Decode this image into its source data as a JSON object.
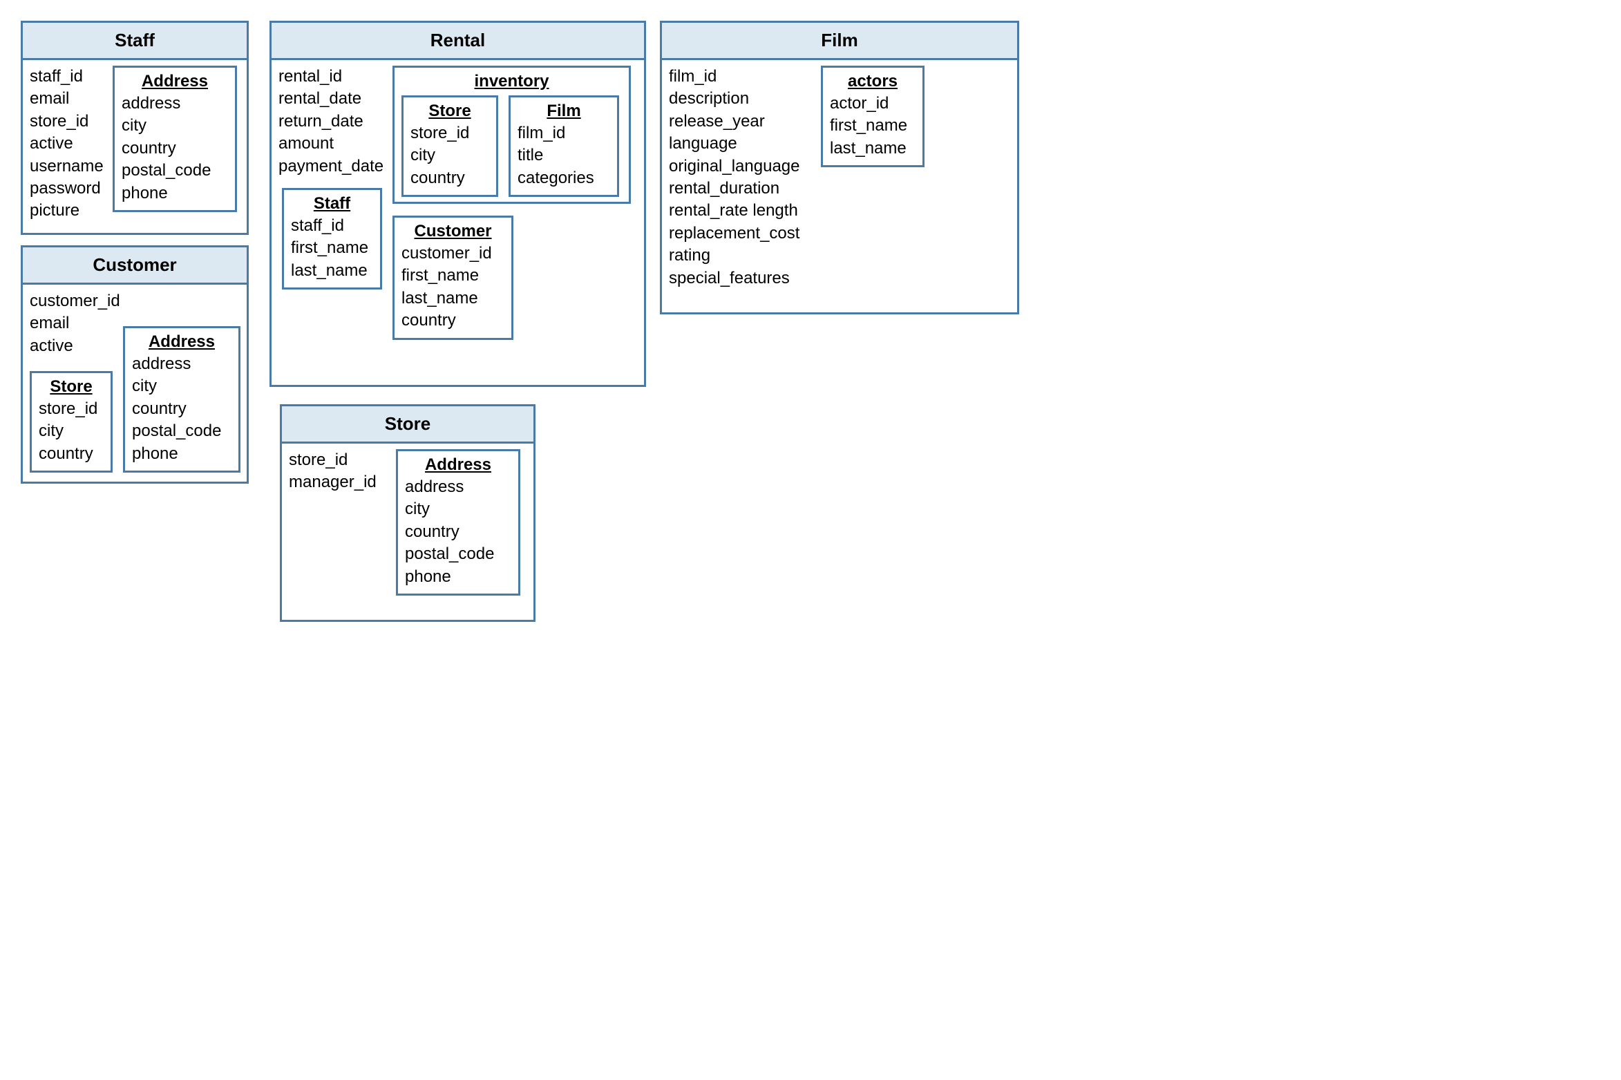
{
  "entities": {
    "staff": {
      "title": "Staff",
      "fields": [
        "staff_id",
        "email",
        "store_id",
        "active",
        "username",
        "password",
        "picture"
      ],
      "nested": {
        "address": {
          "title": "Address",
          "fields": [
            "address",
            "city",
            "country",
            "postal_code",
            "phone"
          ]
        }
      }
    },
    "customer": {
      "title": "Customer",
      "fields": [
        "customer_id",
        "email",
        "active"
      ],
      "nested": {
        "store": {
          "title": "Store",
          "fields": [
            "store_id",
            "city",
            "country"
          ]
        },
        "address": {
          "title": "Address",
          "fields": [
            "address",
            "city",
            "country",
            "postal_code",
            "phone"
          ]
        }
      }
    },
    "rental": {
      "title": "Rental",
      "fields": [
        "rental_id",
        "rental_date",
        "return_date",
        "amount",
        "payment_date"
      ],
      "nested": {
        "inventory": {
          "title": "inventory",
          "nested": {
            "store": {
              "title": "Store",
              "fields": [
                "store_id",
                "city",
                "country"
              ]
            },
            "film": {
              "title": "Film",
              "fields": [
                "film_id",
                "title",
                "categories"
              ]
            }
          }
        },
        "staff": {
          "title": "Staff",
          "fields": [
            "staff_id",
            "first_name",
            "last_name"
          ]
        },
        "customer": {
          "title": "Customer",
          "fields": [
            "customer_id",
            "first_name",
            "last_name",
            "country"
          ]
        }
      }
    },
    "store": {
      "title": "Store",
      "fields": [
        "store_id",
        "manager_id"
      ],
      "nested": {
        "address": {
          "title": "Address",
          "fields": [
            "address",
            "city",
            "country",
            "postal_code",
            "phone"
          ]
        }
      }
    },
    "film": {
      "title": "Film",
      "fields": [
        "film_id",
        "description",
        "release_year",
        "language",
        "original_language",
        "rental_duration",
        "rental_rate length",
        "replacement_cost",
        "rating",
        "special_features"
      ],
      "nested": {
        "actors": {
          "title": "actors",
          "fields": [
            "actor_id",
            "first_name",
            "last_name"
          ]
        }
      }
    }
  }
}
